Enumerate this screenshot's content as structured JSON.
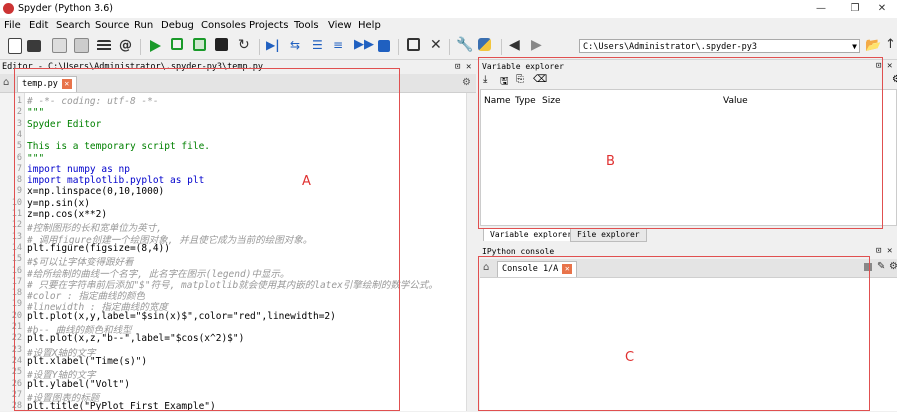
{
  "window": {
    "title": "Spyder (Python 3.6)",
    "buttons": [
      "—",
      "❐",
      "✕"
    ]
  },
  "menu": [
    "File",
    "Edit",
    "Search",
    "Source",
    "Run",
    "Debug",
    "Consoles",
    "Projects",
    "Tools",
    "View",
    "Help"
  ],
  "toolbar": {
    "path": "C:\\Users\\Administrator\\.spyder-py3"
  },
  "editor": {
    "header": "Editor - C:\\Users\\Administrator\\.spyder-py3\\temp.py",
    "tab": "temp.py",
    "lines": [
      {
        "n": "1",
        "t": "# -*- coding: utf-8 -*-"
      },
      {
        "n": "2",
        "t": "\"\"\""
      },
      {
        "n": "3",
        "t": "Spyder Editor"
      },
      {
        "n": "4",
        "t": ""
      },
      {
        "n": "5",
        "t": "This is a temporary script file."
      },
      {
        "n": "6",
        "t": "\"\"\""
      },
      {
        "n": "7",
        "t": "import numpy as np"
      },
      {
        "n": "8",
        "t": "import matplotlib.pyplot as plt"
      },
      {
        "n": "9",
        "t": "x=np.linspace(0,10,1000)"
      },
      {
        "n": "10",
        "t": "y=np.sin(x)"
      },
      {
        "n": "11",
        "t": "z=np.cos(x**2)"
      },
      {
        "n": "12",
        "t": "#控制图形的长和宽单位为英寸,"
      },
      {
        "n": "13",
        "t": "# 调用figure创建一个绘图对象, 并且使它成为当前的绘图对象。"
      },
      {
        "n": "14",
        "t": "plt.figure(figsize=(8,4))"
      },
      {
        "n": "15",
        "t": "#$可以让字体变得跟好看"
      },
      {
        "n": "16",
        "t": "#给所绘制的曲线一个名字, 此名字在图示(legend)中显示。"
      },
      {
        "n": "17",
        "t": "# 只要在字符串前后添加\"$\"符号, matplotlib就会使用其内嵌的latex引擎绘制的数学公式。"
      },
      {
        "n": "18",
        "t": "#color : 指定曲线的颜色"
      },
      {
        "n": "19",
        "t": "#linewidth : 指定曲线的宽度"
      },
      {
        "n": "20",
        "t": "plt.plot(x,y,label=\"$sin(x)$\",color=\"red\",linewidth=2)"
      },
      {
        "n": "21",
        "t": "#b-- 曲线的颜色和线型"
      },
      {
        "n": "22",
        "t": "plt.plot(x,z,\"b--\",label=\"$cos(x^2)$\")"
      },
      {
        "n": "23",
        "t": "#设置X轴的文字"
      },
      {
        "n": "24",
        "t": "plt.xlabel(\"Time(s)\")"
      },
      {
        "n": "25",
        "t": "#设置Y轴的文字"
      },
      {
        "n": "26",
        "t": "plt.ylabel(\"Volt\")"
      },
      {
        "n": "27",
        "t": "#设置图表的标题"
      },
      {
        "n": "28",
        "t": "plt.title(\"PyPlot First Example\")"
      }
    ]
  },
  "variable_explorer": {
    "header": "Variable explorer",
    "columns": [
      "Name",
      "Type",
      "Size",
      "Value"
    ],
    "tabs": [
      "Variable explorer",
      "File explorer"
    ]
  },
  "ipython": {
    "header": "IPython console",
    "tab": "Console 1/A"
  },
  "annotations": [
    "A",
    "B",
    "C"
  ],
  "colors": {
    "annotation": "#e03030",
    "keyword": "#0000cc",
    "string": "#008000",
    "comment": "#999999"
  }
}
